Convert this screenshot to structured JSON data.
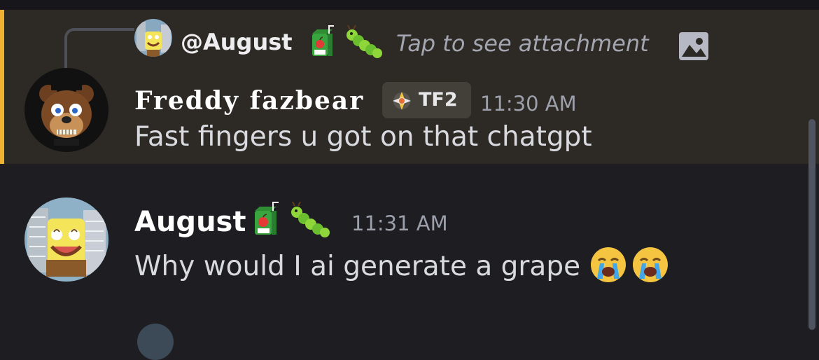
{
  "reply": {
    "author": "@August",
    "preview": "Tap to see attachment",
    "emojis": [
      "juice-box",
      "caterpillar"
    ],
    "preview_icon": "image-icon"
  },
  "messages": [
    {
      "author": "Freddy fazbear",
      "tag": "TF2",
      "timestamp": "11:30 AM",
      "text": "Fast fingers u got on that chatgpt",
      "mention_highlight_color": "#f0b232"
    },
    {
      "author": "August",
      "author_emojis": [
        "juice-box",
        "caterpillar"
      ],
      "timestamp": "11:31 AM",
      "text": "Why would I ai generate a grape",
      "trailing_emojis": [
        "loudly-crying-face",
        "loudly-crying-face"
      ]
    }
  ],
  "colors": {
    "background": "#1d1d22",
    "highlight_background": "#2d2924",
    "mention_bar": "#f0b232"
  }
}
